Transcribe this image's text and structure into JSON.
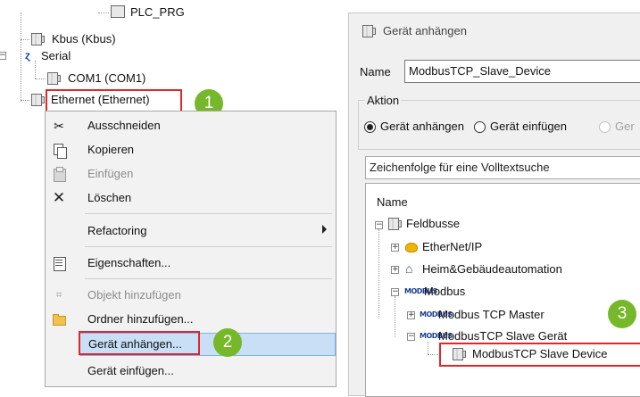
{
  "tree": {
    "plc_prg": "PLC_PRG",
    "kbus": "Kbus (Kbus)",
    "serial": "Serial",
    "com1": "COM1 (COM1)",
    "ethernet": "Ethernet (Ethernet)"
  },
  "context_menu": {
    "items": [
      {
        "label": "Ausschneiden",
        "icon": "scissors-icon"
      },
      {
        "label": "Kopieren",
        "icon": "copy-icon"
      },
      {
        "label": "Einfügen",
        "icon": "paste-icon"
      },
      {
        "label": "Löschen",
        "icon": "delete-icon"
      },
      {
        "label": "Refactoring",
        "icon": ""
      },
      {
        "label": "Eigenschaften...",
        "icon": "properties-icon"
      },
      {
        "label": "Objekt hinzufügen",
        "icon": "add-object-icon"
      },
      {
        "label": "Ordner hinzufügen...",
        "icon": "folder-icon"
      },
      {
        "label": "Gerät anhängen...",
        "icon": ""
      },
      {
        "label": "Gerät einfügen...",
        "icon": ""
      }
    ]
  },
  "dialog": {
    "title": "Gerät anhängen",
    "name_label": "Name",
    "name_value": "ModbusTCP_Slave_Device",
    "action_label": "Aktion",
    "radio_append": "Gerät anhängen",
    "radio_insert": "Gerät einfügen",
    "radio_third": "Ger",
    "search_placeholder": "Zeichenfolge für eine Volltextsuche",
    "tree_header": "Name",
    "tree": {
      "fieldbusses": "Feldbusse",
      "ethernetip": "EtherNet/IP",
      "home_automation": "Heim&Gebäudeautomation",
      "modbus": "Modbus",
      "modbus_tcp_master": "Modbus TCP Master",
      "modbus_tcp_slave_group": "ModbusTCP Slave Gerät",
      "modbus_tcp_slave_device": "ModbusTCP Slave Device"
    },
    "modbus_glyph": "MODBUS"
  },
  "callouts": [
    "1",
    "2",
    "3"
  ],
  "colors": {
    "callout": "#76b82a",
    "highlight_box": "#e0262b",
    "menu_selected": "#c8dff5"
  }
}
